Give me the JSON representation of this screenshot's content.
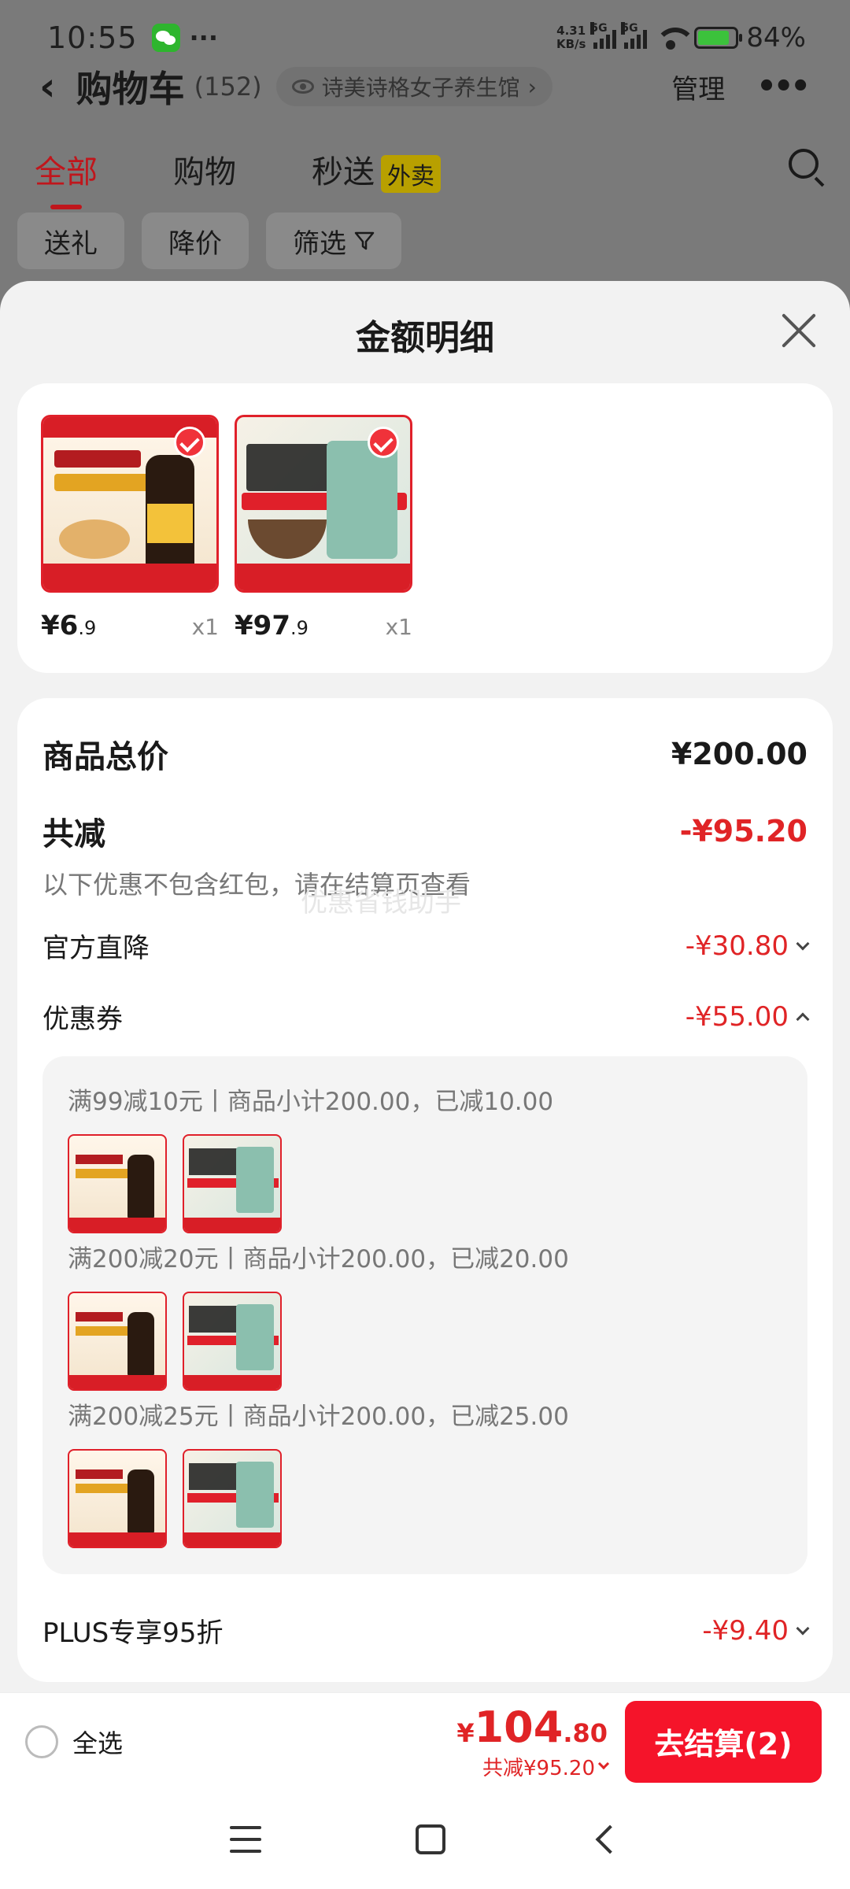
{
  "status_bar": {
    "time": "10:55",
    "more": "···",
    "net_speed_value": "4.31",
    "net_speed_unit": "KB/s",
    "sig1_tag": "5G",
    "sig2_tag": "5G",
    "battery_pct": "84%",
    "battery_level": 0.84
  },
  "background_page": {
    "back_icon": "back-arrow-icon",
    "title": "购物车",
    "count": "(152)",
    "store_name": "诗美诗格女子养生馆",
    "store_chevron": "›",
    "manage": "管理",
    "more": "•••",
    "tabs": [
      {
        "label": "全部",
        "active": true
      },
      {
        "label": "购物",
        "active": false
      },
      {
        "label": "秒送",
        "active": false,
        "badge": "外卖"
      }
    ],
    "filters": [
      {
        "label": "送礼"
      },
      {
        "label": "降价"
      },
      {
        "label": "筛选",
        "icon": "funnel-icon"
      }
    ]
  },
  "sheet": {
    "title": "金额明细",
    "products": [
      {
        "price_int": "¥6",
        "price_dec": ".9",
        "qty": "x1",
        "thumb": "soy-sauce-product",
        "checked": true
      },
      {
        "price_int": "¥97",
        "price_dec": ".9",
        "qty": "x1",
        "thumb": "pet-food-product",
        "checked": true
      }
    ],
    "total_label": "商品总价",
    "total_value": "¥200.00",
    "discount_label": "共减",
    "discount_value": "-¥95.20",
    "discount_note": "以下优惠不包含红包，请在结算页查看",
    "watermark": "优惠省钱助手",
    "official_label": "官方直降",
    "official_value": "-¥30.80",
    "coupon_label": "优惠券",
    "coupon_value": "-¥55.00",
    "coupon_groups": [
      {
        "text": "满99减10元丨商品小计200.00，已减10.00"
      },
      {
        "text": "满200减20元丨商品小计200.00，已减20.00"
      },
      {
        "text": "满200减25元丨商品小计200.00，已减25.00"
      }
    ],
    "plus_label": "PLUS专享95折",
    "plus_value": "-¥9.40"
  },
  "checkout": {
    "select_all": "全选",
    "price_symbol": "¥",
    "price_int": "104",
    "price_dec": ".80",
    "discount": "共减¥95.20",
    "button": "去结算(2)"
  },
  "colors": {
    "accent_red": "#e02426",
    "checkout_red": "#f5142a",
    "overlay_gray": "#7a7a7a"
  }
}
